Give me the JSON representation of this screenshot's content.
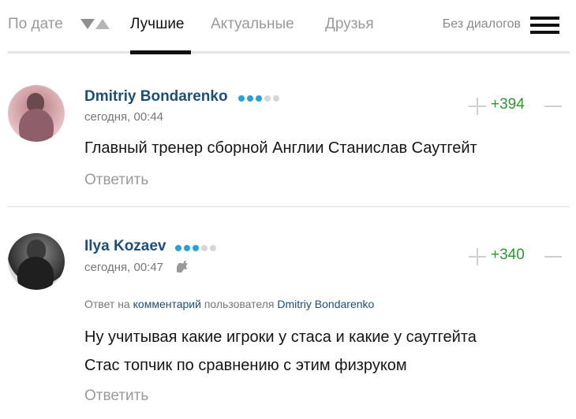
{
  "tabs": {
    "by_date": "По дате",
    "best": "Лучшие",
    "actual": "Актуальные",
    "friends": "Друзья",
    "no_dialogs": "Без диалогов"
  },
  "comments": [
    {
      "author": "Dmitriy Bondarenko",
      "rating_dots": [
        1,
        1,
        1,
        0,
        0
      ],
      "time": "сегодня, 00:44",
      "score": "+394",
      "text": "Главный тренер сборной Англии Станислав Саутгейт",
      "reply": "Ответить"
    },
    {
      "author": "Ilya Kozaev",
      "rating_dots": [
        1,
        1,
        1,
        0,
        0
      ],
      "time": "сегодня, 00:47",
      "device_icon": "apple-icon",
      "reply_to": {
        "prefix": "Ответ на",
        "link": "комментарий",
        "middle": "пользователя",
        "user": "Dmitriy Bondarenko"
      },
      "text_lines": [
        "Ну учитывая какие игроки у стаса и какие у саутгейта",
        "Стас топчик по сравнению с этим физруком"
      ],
      "score": "+340",
      "reply": "Ответить"
    }
  ],
  "colors": {
    "author": "#1e4e78",
    "score": "#2a9a2a",
    "dot_active": "#2a9fd8",
    "dot_inactive": "#d6d6d6"
  }
}
